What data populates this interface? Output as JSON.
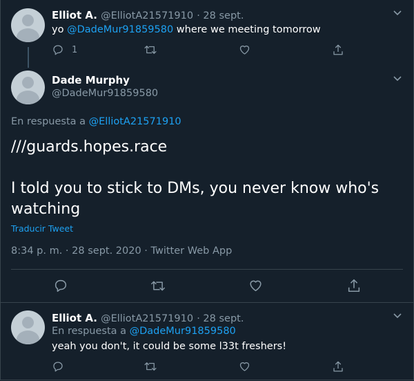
{
  "tweet1": {
    "name": "Elliot A.",
    "handle": "@ElliotA21571910",
    "date": "· 28 sept.",
    "text_prefix": "yo ",
    "mention": "@DadeMur91859580",
    "text_suffix": " where we meeting tomorrow",
    "reply_count": "1",
    "icons": [
      "reply-icon",
      "retweet-icon",
      "like-icon",
      "share-icon"
    ]
  },
  "tweet2": {
    "name": "Dade Murphy",
    "handle": "@DadeMur91859580",
    "reply_prefix": "En respuesta a ",
    "reply_to": "@ElliotA21571910",
    "line1": "///guards.hopes.race",
    "line2": "I told you to stick to DMs, you never know who's watching",
    "translate": "Traducir Tweet",
    "meta": "8:34 p. m. · 28 sept. 2020 · Twitter Web App"
  },
  "tweet3": {
    "name": "Elliot A.",
    "handle": "@ElliotA21571910",
    "date": "· 28 sept.",
    "reply_prefix": "En respuesta a ",
    "reply_to": "@DadeMur91859580",
    "text": "yeah you don't, it could be some l33t freshers!"
  },
  "colors": {
    "background": "#15202b",
    "accent": "#1da1f2",
    "muted": "#8899a6",
    "border": "#38444d"
  }
}
